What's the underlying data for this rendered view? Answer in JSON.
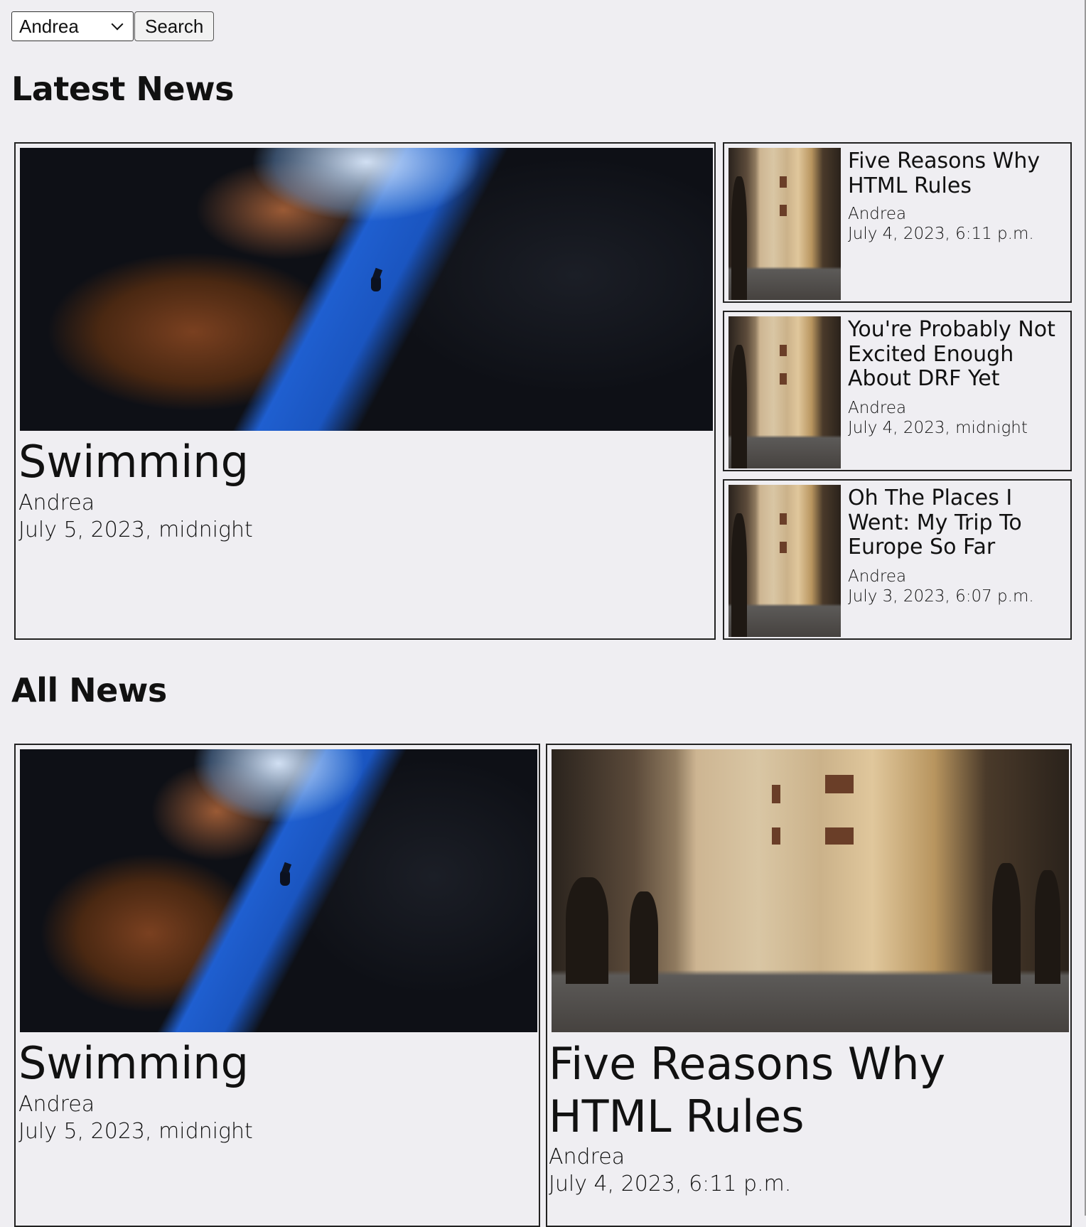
{
  "search": {
    "selected_author": "Andrea",
    "button_label": "Search"
  },
  "latest": {
    "heading": "Latest News",
    "featured": {
      "title": "Swimming",
      "author": "Andrea",
      "date": "July 5, 2023, midnight"
    },
    "side": [
      {
        "title": "Five Reasons Why HTML Rules",
        "author": "Andrea",
        "date": "July 4, 2023, 6:11 p.m."
      },
      {
        "title": "You're Probably Not Excited Enough About DRF Yet",
        "author": "Andrea",
        "date": "July 4, 2023, midnight"
      },
      {
        "title": "Oh The Places I Went: My Trip To Europe So Far",
        "author": "Andrea",
        "date": "July 3, 2023, 6:07 p.m."
      }
    ]
  },
  "all": {
    "heading": "All News",
    "items": [
      {
        "title": "Swimming",
        "author": "Andrea",
        "date": "July 5, 2023, midnight"
      },
      {
        "title": "Five Reasons Why HTML Rules",
        "author": "Andrea",
        "date": "July 4, 2023, 6:11 p.m."
      }
    ]
  },
  "colors": {
    "background": "#efeef2",
    "border": "#222222"
  }
}
